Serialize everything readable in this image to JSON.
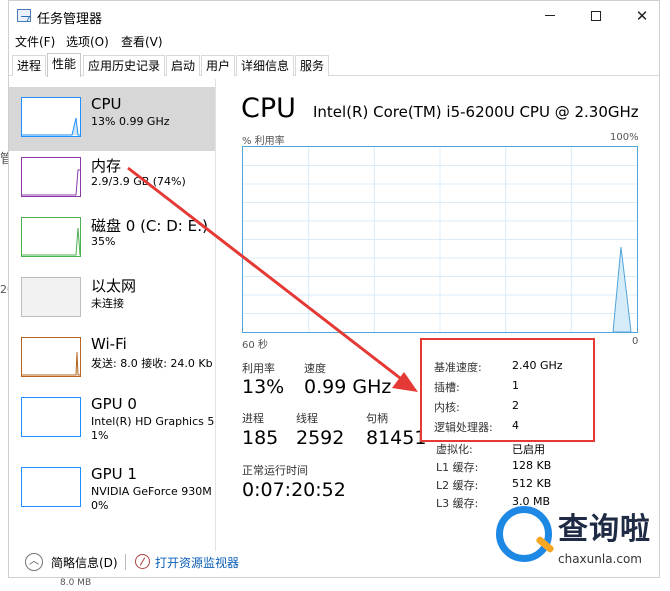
{
  "window": {
    "title": "任务管理器",
    "min_glyph": "",
    "max_glyph": "",
    "close_glyph": "✕"
  },
  "menu": [
    "文件(F)",
    "选项(O)",
    "查看(V)"
  ],
  "tabs": [
    "进程",
    "性能",
    "应用历史记录",
    "启动",
    "用户",
    "详细信息",
    "服务"
  ],
  "active_tab": "性能",
  "sidebar": [
    {
      "name": "CPU",
      "sub": "13% 0.99 GHz",
      "sub2": "",
      "color": "#1e90ff"
    },
    {
      "name": "内存",
      "sub": "2.9/3.9 GB (74%)",
      "sub2": "",
      "color": "#8b3aa8"
    },
    {
      "name": "磁盘 0 (C: D: E:)",
      "sub": "35%",
      "sub2": "",
      "color": "#4caf50"
    },
    {
      "name": "以太网",
      "sub": "未连接",
      "sub2": "",
      "color": "#a0a0a0"
    },
    {
      "name": "Wi-Fi",
      "sub": "发送: 8.0  接收: 24.0 Kb",
      "sub2": "",
      "color": "#b5651d"
    },
    {
      "name": "GPU 0",
      "sub": "Intel(R) HD Graphics 5",
      "sub2": "1%",
      "color": "#1e90ff"
    },
    {
      "name": "GPU 1",
      "sub": "NVIDIA GeForce 930M",
      "sub2": "0%",
      "color": "#1e90ff"
    }
  ],
  "cpu": {
    "title": "CPU",
    "model": "Intel(R) Core(TM) i5-6200U CPU @ 2.30GHz",
    "util_label": "% 利用率",
    "util_max": "100%",
    "axis_left": "60 秒",
    "axis_right": "0",
    "graph_color": "#4fa3d9"
  },
  "stats": {
    "util_label": "利用率",
    "util_value": "13%",
    "speed_label": "速度",
    "speed_value": "0.99 GHz",
    "proc_label": "进程",
    "proc_value": "185",
    "thread_label": "线程",
    "thread_value": "2592",
    "handle_label": "句柄",
    "handle_value": "81451",
    "uptime_label": "正常运行时间",
    "uptime_value": "0:07:20:52"
  },
  "specs_highlight": [
    {
      "k": "基准速度:",
      "v": "2.40 GHz"
    },
    {
      "k": "插槽:",
      "v": "1"
    },
    {
      "k": "内核:",
      "v": "2"
    },
    {
      "k": "逻辑处理器:",
      "v": "4"
    }
  ],
  "specs_rest": [
    {
      "k": "虚拟化:",
      "v": "已启用"
    },
    {
      "k": "L1 缓存:",
      "v": "128 KB"
    },
    {
      "k": "L2 缓存:",
      "v": "512 KB"
    },
    {
      "k": "L3 缓存:",
      "v": "3.0 MB"
    }
  ],
  "footer": {
    "less": "简略信息(D)",
    "monitor": "打开资源监视器",
    "up_glyph": "︿"
  },
  "watermark": {
    "cn": "查询啦",
    "url": "chaxunla.com"
  },
  "annotation_color": "#e53935",
  "edge_texts": [
    "管",
    "20",
    "8.0 MB"
  ]
}
